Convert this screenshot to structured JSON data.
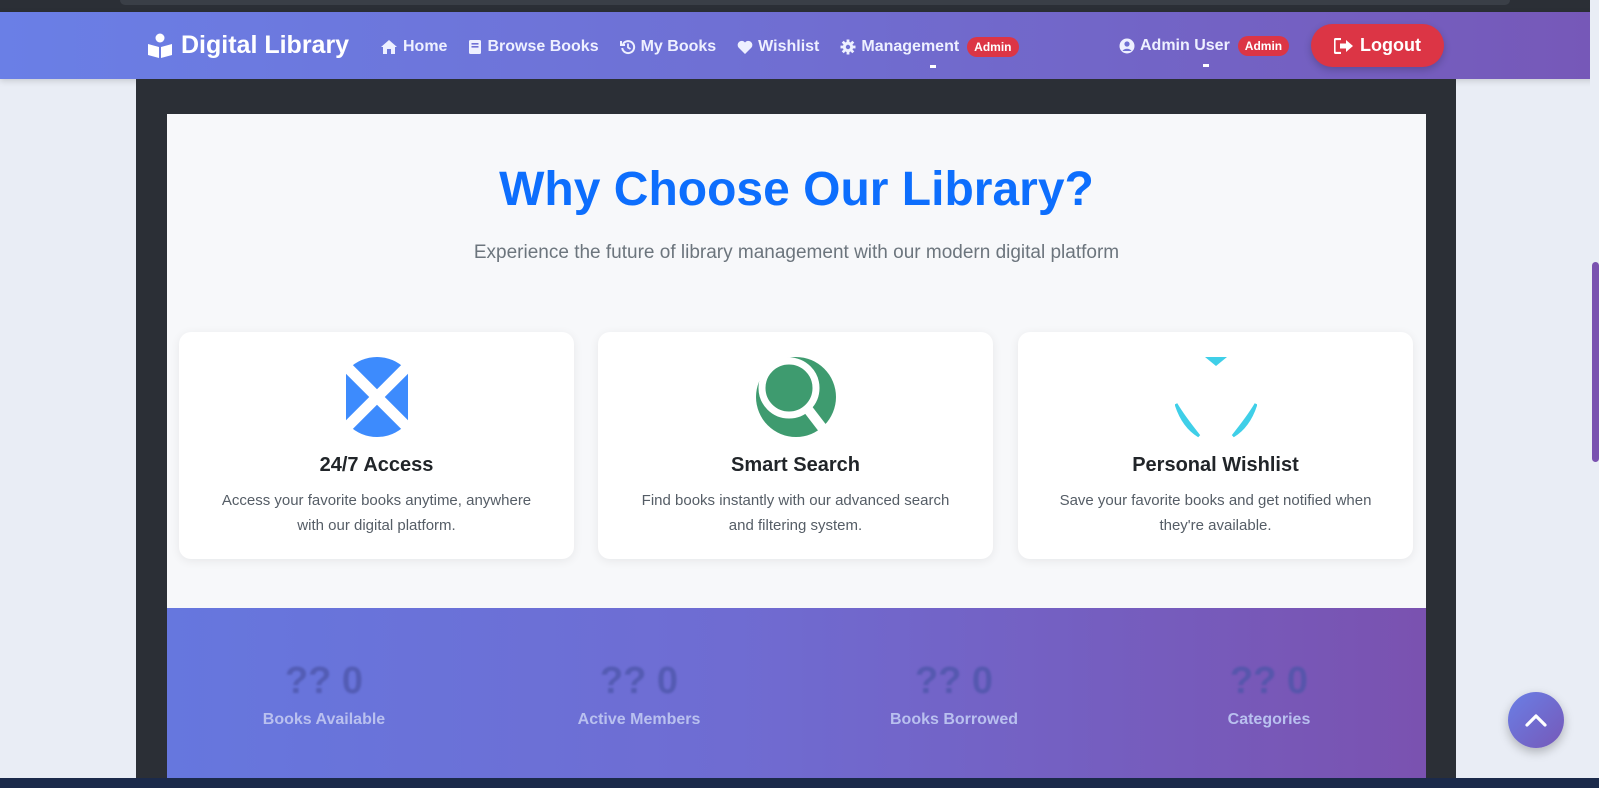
{
  "navbar": {
    "brand": "Digital Library",
    "links": [
      {
        "label": "Home",
        "icon": "home-icon"
      },
      {
        "label": "Browse Books",
        "icon": "book-icon"
      },
      {
        "label": "My Books",
        "icon": "history-icon"
      },
      {
        "label": "Wishlist",
        "icon": "heart-icon"
      },
      {
        "label": "Management",
        "icon": "gear-icon",
        "badge": "Admin"
      }
    ],
    "user": {
      "name": "Admin User",
      "badge": "Admin"
    },
    "logout_label": "Logout"
  },
  "features": {
    "title": "Why Choose Our Library?",
    "subtitle": "Experience the future of library management with our modern digital platform",
    "cards": [
      {
        "title": "24/7 Access",
        "description": "Access your favorite books anytime, anywhere with our digital platform.",
        "icon": "clock-icon",
        "color": "#3d8bfd"
      },
      {
        "title": "Smart Search",
        "description": "Find books instantly with our advanced search and filtering system.",
        "icon": "search-icon",
        "color": "#3e9b6f"
      },
      {
        "title": "Personal Wishlist",
        "description": "Save your favorite books and get notified when they're available.",
        "icon": "heart-icon",
        "color": "#3fcfe8"
      }
    ]
  },
  "stats": [
    {
      "value": "?? 0",
      "label": "Books Available"
    },
    {
      "value": "?? 0",
      "label": "Active Members"
    },
    {
      "value": "?? 0",
      "label": "Books Borrowed"
    },
    {
      "value": "?? 0",
      "label": "Categories"
    }
  ],
  "colors": {
    "accent": "#0d6efd",
    "danger": "#dc3545",
    "gradient_start": "#6a7fe6",
    "gradient_end": "#7658b8"
  }
}
